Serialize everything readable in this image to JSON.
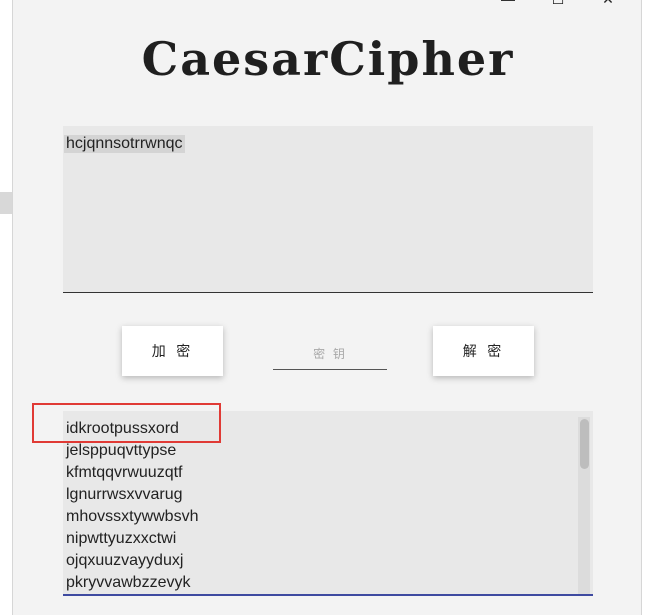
{
  "window": {
    "controls": [
      "—",
      "☐",
      "✕"
    ],
    "title": "CaesarCipher"
  },
  "input": {
    "text": "hcjqnnsotrrwnqc"
  },
  "buttons": {
    "encrypt": "加 密",
    "decrypt": "解 密"
  },
  "key": {
    "placeholder": "密 钥",
    "value": ""
  },
  "output": {
    "lines": [
      "idkrootpussxord",
      "jelsppuqvttypse",
      "kfmtqqvrwuuzqtf",
      "lgnurrwsxvvarug",
      "mhovssxtywwbsvh",
      "nipwttyuzxxctwi",
      "ojqxuuzvayyduxj",
      "pkryvvawbzzevyk"
    ]
  },
  "annotation": {
    "color": "#e03a35"
  },
  "accent_color": "#3e4aa0"
}
